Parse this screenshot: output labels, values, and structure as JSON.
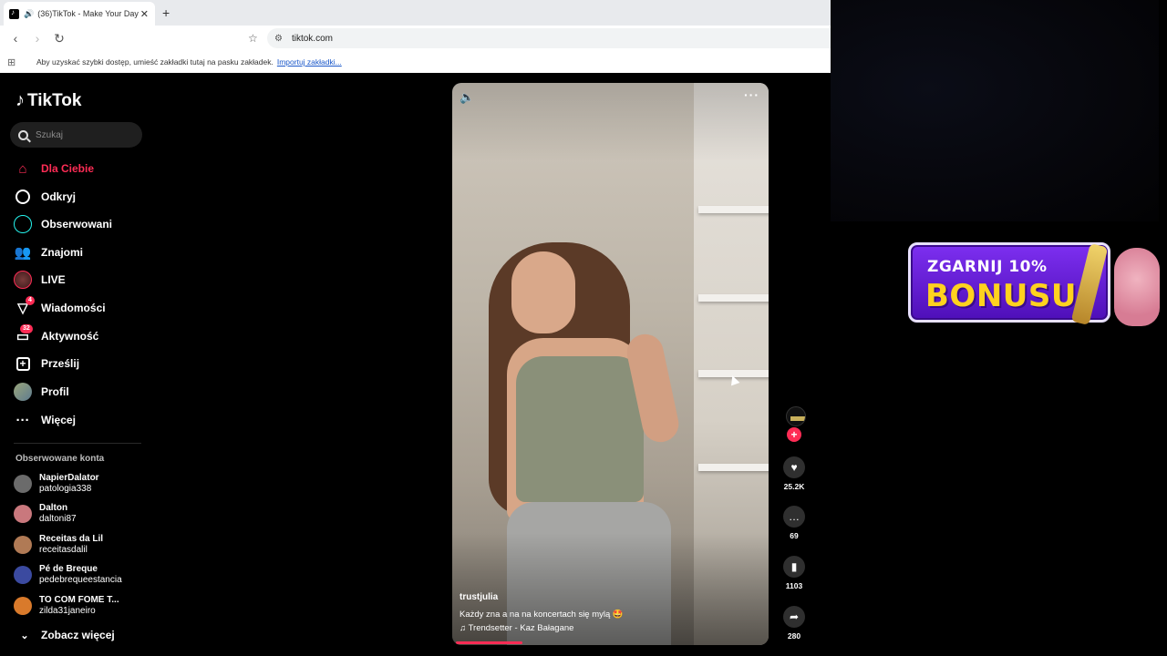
{
  "browser": {
    "tab_title": "(36)TikTok - Make Your Day",
    "tab_close": "✕",
    "new_tab": "+",
    "url": "tiktok.com",
    "bookmarks_hint": "Aby uzyskać szybki dostęp, umieść zakładki tutaj na pasku zakładek.",
    "bookmarks_import": "Importuj zakładki..."
  },
  "tiktok": {
    "logo_text": "TikTok",
    "search_placeholder": "Szukaj",
    "nav": [
      {
        "label": "Dla Ciebie",
        "icon": "home-icon",
        "active": true
      },
      {
        "label": "Odkryj",
        "icon": "compass-icon"
      },
      {
        "label": "Obserwowani",
        "icon": "following-icon"
      },
      {
        "label": "Znajomi",
        "icon": "friends-icon"
      },
      {
        "label": "LIVE",
        "icon": "live-icon"
      },
      {
        "label": "Wiadomości",
        "icon": "inbox-icon",
        "badge": "4"
      },
      {
        "label": "Aktywność",
        "icon": "activity-icon",
        "badge": "32"
      },
      {
        "label": "Prześlij",
        "icon": "upload-icon"
      },
      {
        "label": "Profil",
        "icon": "profile-icon"
      },
      {
        "label": "Więcej",
        "icon": "more-icon"
      }
    ],
    "following_title": "Obserwowane konta",
    "following": [
      {
        "name": "NapierDalator",
        "handle": "patologia338",
        "color": "#6b6b6b"
      },
      {
        "name": "Dalton",
        "handle": "daltoni87",
        "color": "#c9787d"
      },
      {
        "name": "Receitas da Lil",
        "handle": "receitasdalil",
        "color": "#b07a55"
      },
      {
        "name": "Pé de Breque",
        "handle": "pedebrequeestancia",
        "color": "#3b4aa0"
      },
      {
        "name": "TO COM FOME T...",
        "handle": "zilda31janeiro",
        "color": "#d97a2b"
      }
    ],
    "see_more": "Zobacz więcej"
  },
  "video": {
    "author": "trustjulia",
    "caption": "Każdy zna a na na koncertach się mylą 🤩",
    "music": "♫ Trendsetter - Kaz Bałagane",
    "progress_fraction": 0.22,
    "likes": "25.2K",
    "comments": "69",
    "saves": "1103",
    "shares": "280"
  },
  "promo": {
    "line1": "ZGARNIJ 10%",
    "line2": "BONUSU"
  },
  "colors": {
    "accent": "#fe2c55",
    "background": "#000000",
    "promo_purple": "#6a20d9",
    "promo_yellow": "#ffd21f"
  }
}
